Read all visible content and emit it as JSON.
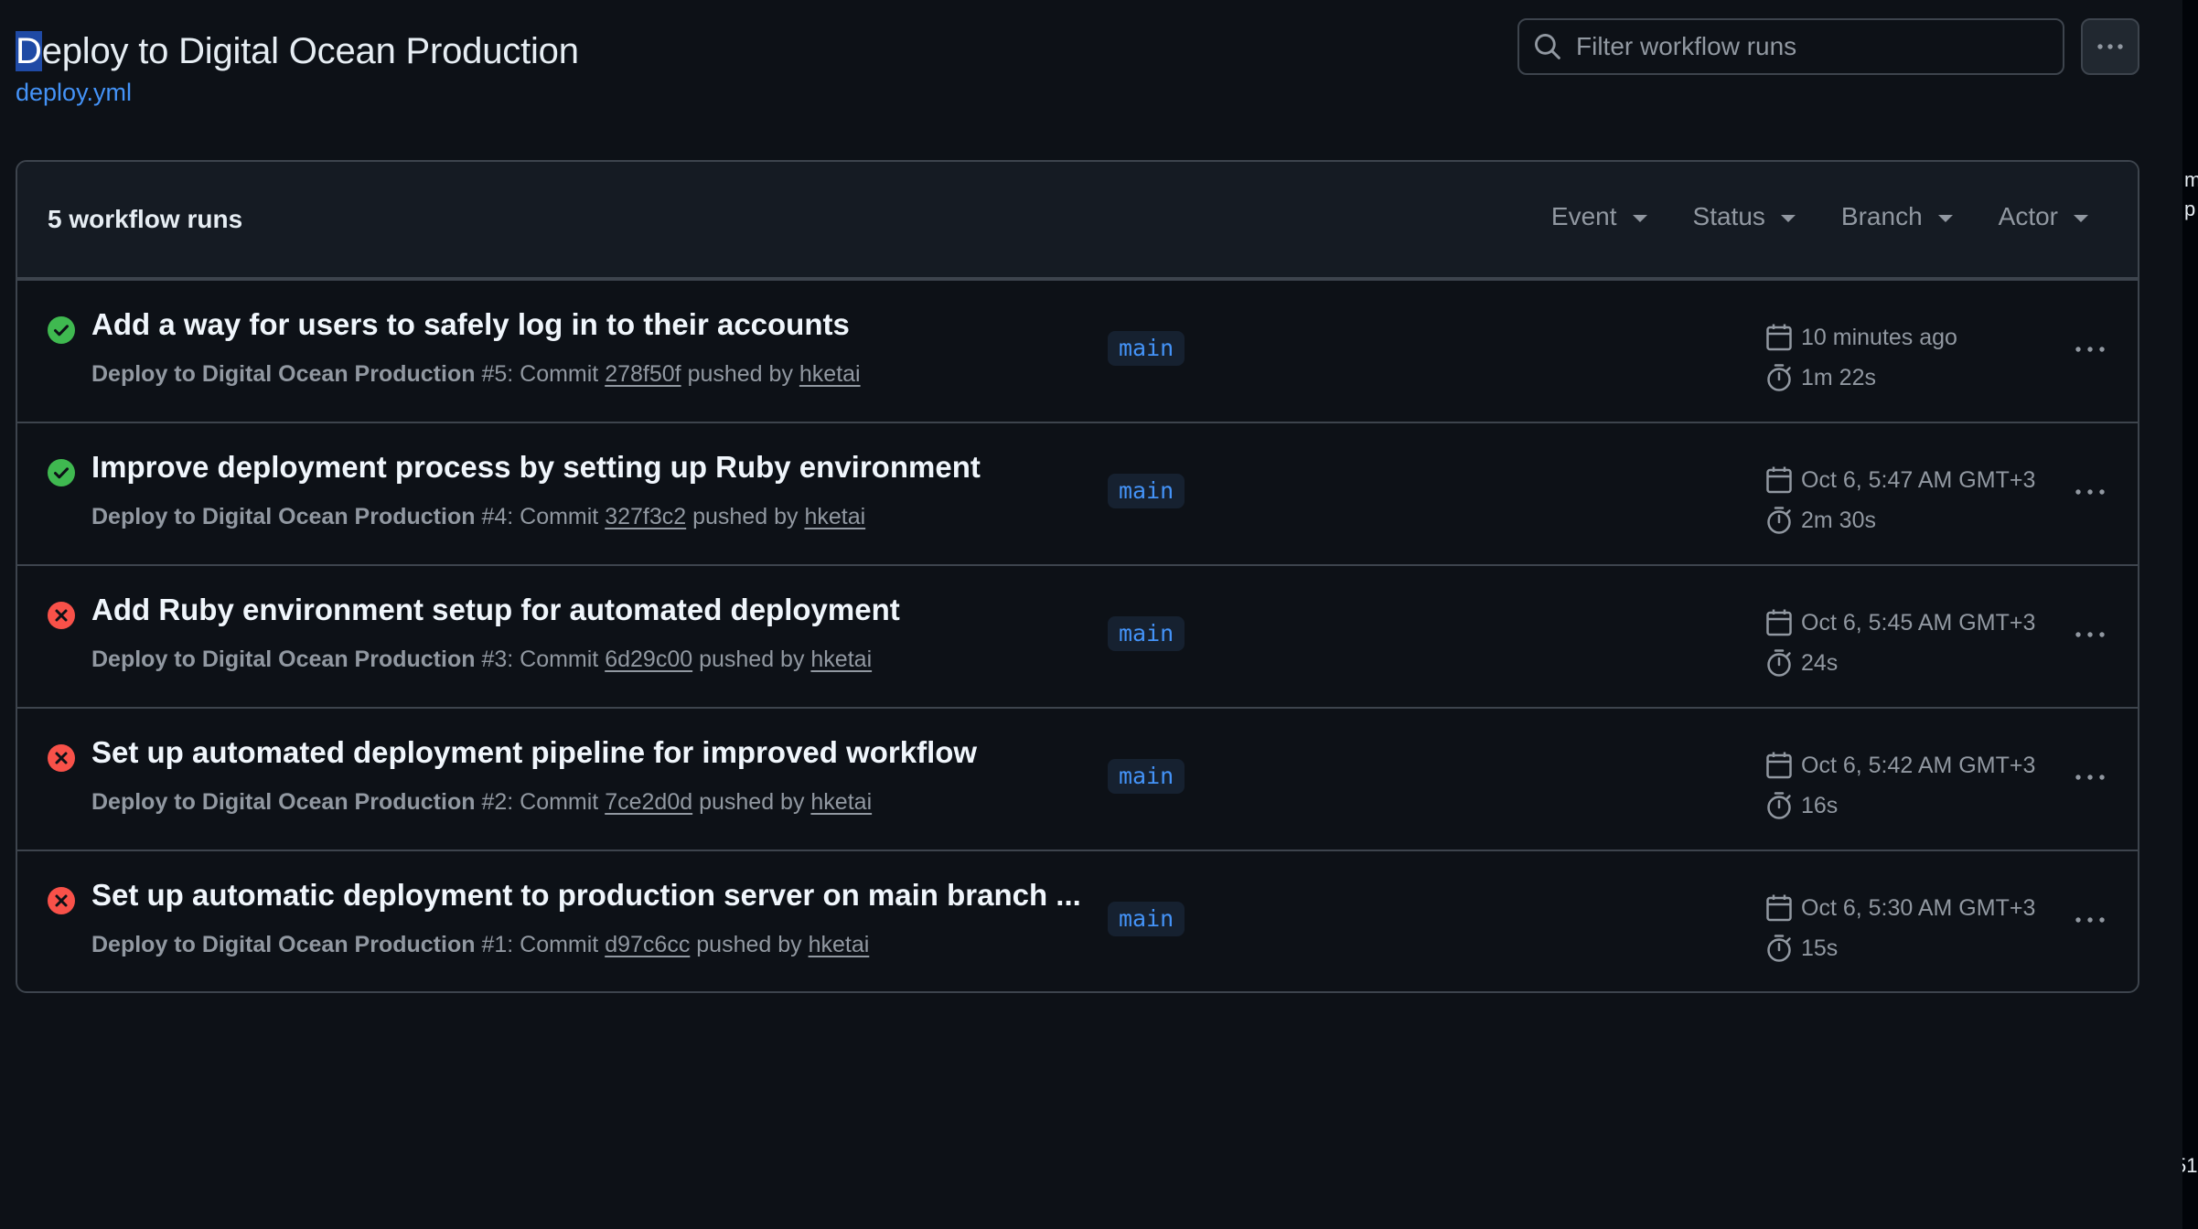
{
  "page": {
    "title_first_letter": "D",
    "title_rest": "eploy to Digital Ocean Production",
    "workflow_file": "deploy.yml"
  },
  "filter": {
    "placeholder": "Filter workflow runs"
  },
  "runs_header": {
    "count_label": "5 workflow runs",
    "filters": [
      {
        "label": "Event"
      },
      {
        "label": "Status"
      },
      {
        "label": "Branch"
      },
      {
        "label": "Actor"
      }
    ]
  },
  "runs": [
    {
      "status": "success",
      "title": "Add a way for users to safely log in to their accounts",
      "workflow_run": "Deploy to Digital Ocean Production",
      "run_number": "#5",
      "commit_prefix": ": Commit ",
      "commit": "278f50f",
      "pushed_by": " pushed by ",
      "actor": "hketai",
      "branch": "main",
      "when": "10 minutes ago",
      "duration": "1m 22s"
    },
    {
      "status": "success",
      "title": "Improve deployment process by setting up Ruby environment",
      "workflow_run": "Deploy to Digital Ocean Production",
      "run_number": "#4",
      "commit_prefix": ": Commit ",
      "commit": "327f3c2",
      "pushed_by": " pushed by ",
      "actor": "hketai",
      "branch": "main",
      "when": "Oct 6, 5:47 AM GMT+3",
      "duration": "2m 30s"
    },
    {
      "status": "failure",
      "title": "Add Ruby environment setup for automated deployment",
      "workflow_run": "Deploy to Digital Ocean Production",
      "run_number": "#3",
      "commit_prefix": ": Commit ",
      "commit": "6d29c00",
      "pushed_by": " pushed by ",
      "actor": "hketai",
      "branch": "main",
      "when": "Oct 6, 5:45 AM GMT+3",
      "duration": "24s"
    },
    {
      "status": "failure",
      "title": "Set up automated deployment pipeline for improved workflow",
      "workflow_run": "Deploy to Digital Ocean Production",
      "run_number": "#2",
      "commit_prefix": ": Commit ",
      "commit": "7ce2d0d",
      "pushed_by": " pushed by ",
      "actor": "hketai",
      "branch": "main",
      "when": "Oct 6, 5:42 AM GMT+3",
      "duration": "16s"
    },
    {
      "status": "failure",
      "title": "Set up automatic deployment to production server on main branch ...",
      "workflow_run": "Deploy to Digital Ocean Production",
      "run_number": "#1",
      "commit_prefix": ": Commit ",
      "commit": "d97c6cc",
      "pushed_by": " pushed by ",
      "actor": "hketai",
      "branch": "main",
      "when": "Oct 6, 5:30 AM GMT+3",
      "duration": "15s"
    }
  ],
  "icons": {
    "success": "check-circle-fill-icon",
    "failure": "x-circle-fill-icon",
    "calendar": "calendar-icon",
    "duration": "stopwatch-icon",
    "search": "search-icon",
    "more": "kebab-horizontal-icon",
    "caret": "triangle-down-icon"
  },
  "colors": {
    "success": "#3fb950",
    "failure": "#f85149",
    "link": "#4493f8",
    "background": "#0d1117",
    "border": "#3d444d"
  },
  "right_strip": {
    "fragments": [
      "m",
      "p",
      "51"
    ]
  }
}
